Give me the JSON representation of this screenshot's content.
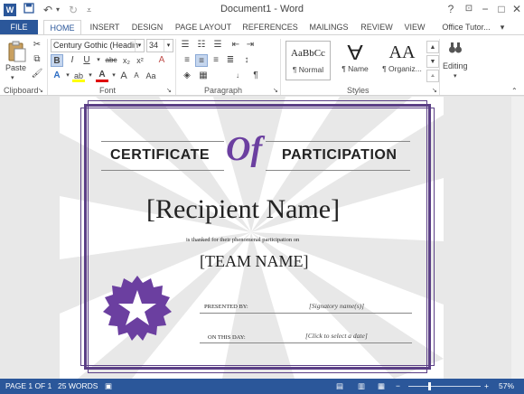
{
  "window": {
    "title": "Document1 - Word",
    "app_icon_letter": "W",
    "help": "?",
    "minimize": "−",
    "maximize": "□",
    "close": "✕"
  },
  "tabs": [
    "FILE",
    "HOME",
    "INSERT",
    "DESIGN",
    "PAGE LAYOUT",
    "REFERENCES",
    "MAILINGS",
    "REVIEW",
    "VIEW",
    "Office Tutor..."
  ],
  "active_tab": "HOME",
  "ribbon": {
    "clipboard": {
      "label": "Clipboard",
      "paste": "Paste"
    },
    "font": {
      "label": "Font",
      "font_name": "Century Gothic (Headin",
      "font_size": "34",
      "bold": "B",
      "italic": "I",
      "underline": "U",
      "strike": "abc",
      "subscript": "x₂",
      "superscript": "x²",
      "grow": "A",
      "shrink": "A",
      "case": "Aa",
      "clear": "A",
      "effects": "A",
      "highlight": "ab",
      "color": "A"
    },
    "paragraph": {
      "label": "Paragraph",
      "pilcrow": "¶"
    },
    "styles": {
      "label": "Styles",
      "items": [
        {
          "sample": "AaBbCc",
          "name": "¶ Normal"
        },
        {
          "sample": "A",
          "name": "¶ Name"
        },
        {
          "sample": "AA",
          "name": "¶ Organiz..."
        }
      ]
    },
    "editing": {
      "label": "Editing"
    }
  },
  "certificate": {
    "heading_left": "CERTIFICATE",
    "heading_of": "Of",
    "heading_right": "PARTICIPATION",
    "recipient": "[Recipient Name]",
    "thanked": "is thanked for their phenomenal participation on",
    "team": "[TEAM NAME]",
    "presented_by": "PRESENTED BY:",
    "signatory": "[Signatory name(s)]",
    "on_this_day": "ON THIS DAY:",
    "date": "[Click to select a date]"
  },
  "statusbar": {
    "page": "PAGE 1 OF 1",
    "words": "25 WORDS",
    "zoom": "57%",
    "zoom_level": 0.57
  },
  "colors": {
    "accent": "#2b579a",
    "certificate_purple": "#5b3f86",
    "seal_purple": "#6b3fa0"
  }
}
